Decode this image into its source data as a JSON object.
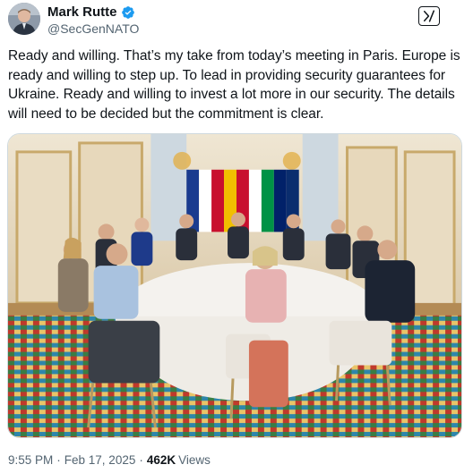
{
  "author": {
    "name": "Mark Rutte",
    "handle": "@SecGenNATO",
    "verified": true
  },
  "tweet": {
    "text": "Ready and willing. That’s my take from today’s meeting in Paris. Europe is ready and willing to step up. To lead in providing security guarantees for Ukraine. Ready and willing to invest a lot more in our security. The details will need  to be decided but the commitment is clear."
  },
  "meta": {
    "time": "9:55 PM",
    "separator": "·",
    "date": "Feb 17, 2025",
    "views_count": "462K",
    "views_label": "Views"
  },
  "icons": {
    "verified": "verified-badge-icon",
    "grok": "grok-icon"
  },
  "colors": {
    "verified": "#1d9bf0",
    "text": "#0f1419",
    "secondary": "#536471",
    "border": "#cfd9de"
  }
}
